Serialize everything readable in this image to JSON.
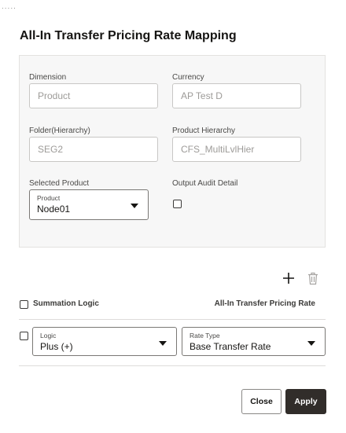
{
  "dialog": {
    "title": "All-In Transfer Pricing Rate Mapping",
    "dots": "....."
  },
  "form": {
    "dimension": {
      "label": "Dimension",
      "value": "Product"
    },
    "currency": {
      "label": "Currency",
      "value": "AP Test D"
    },
    "folder": {
      "label": "Folder(Hierarchy)",
      "value": "SEG2"
    },
    "product_hierarchy": {
      "label": "Product Hierarchy",
      "value": "CFS_MultiLvlHier"
    },
    "selected_product": {
      "label": "Selected Product",
      "select_label": "Product",
      "select_value": "Node01"
    },
    "output_audit": {
      "label": "Output Audit Detail",
      "checked": false
    }
  },
  "table": {
    "add_icon": "plus-icon",
    "delete_icon": "trash-icon",
    "summation_label": "Summation Logic",
    "rate_header": "All-In Transfer Pricing Rate",
    "row": {
      "logic": {
        "label": "Logic",
        "value": "Plus (+)"
      },
      "rate_type": {
        "label": "Rate Type",
        "value": "Base Transfer Rate"
      }
    }
  },
  "footer": {
    "close_label": "Close",
    "apply_label": "Apply"
  },
  "colors": {
    "primary_button": "#312d2a",
    "panel_bg": "#f7f7f7"
  }
}
